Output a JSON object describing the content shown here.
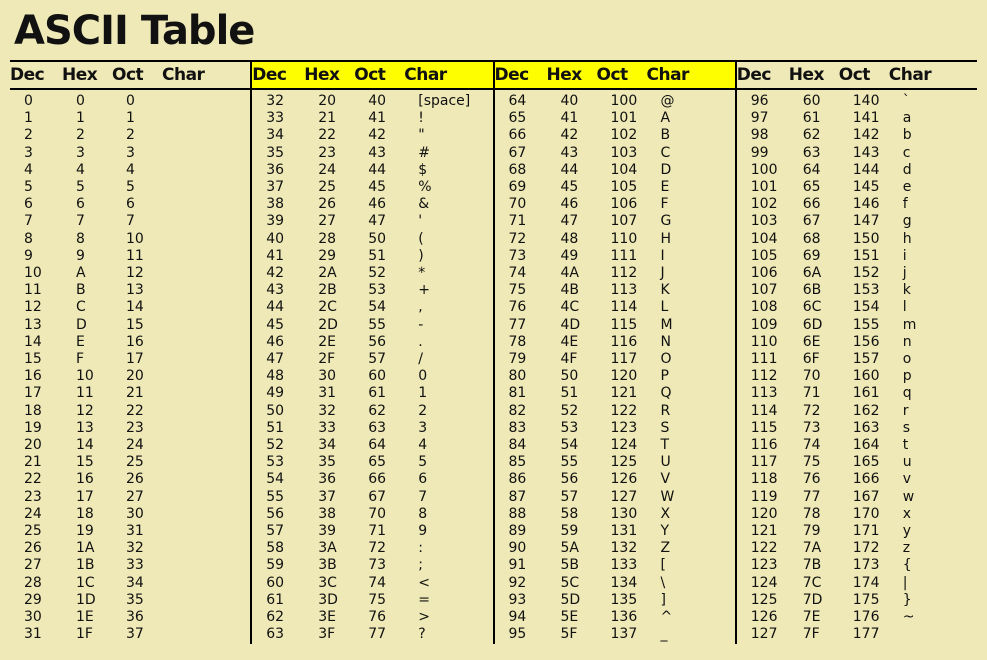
{
  "title": "ASCII Table",
  "headers": {
    "dec": "Dec",
    "hex": "Hex",
    "oct": "Oct",
    "char": "Char"
  },
  "highlight_columns": [
    1,
    2
  ],
  "columns": [
    [
      {
        "dec": "0",
        "hex": "0",
        "oct": "0",
        "char": ""
      },
      {
        "dec": "1",
        "hex": "1",
        "oct": "1",
        "char": ""
      },
      {
        "dec": "2",
        "hex": "2",
        "oct": "2",
        "char": ""
      },
      {
        "dec": "3",
        "hex": "3",
        "oct": "3",
        "char": ""
      },
      {
        "dec": "4",
        "hex": "4",
        "oct": "4",
        "char": ""
      },
      {
        "dec": "5",
        "hex": "5",
        "oct": "5",
        "char": ""
      },
      {
        "dec": "6",
        "hex": "6",
        "oct": "6",
        "char": ""
      },
      {
        "dec": "7",
        "hex": "7",
        "oct": "7",
        "char": ""
      },
      {
        "dec": "8",
        "hex": "8",
        "oct": "10",
        "char": ""
      },
      {
        "dec": "9",
        "hex": "9",
        "oct": "11",
        "char": ""
      },
      {
        "dec": "10",
        "hex": "A",
        "oct": "12",
        "char": ""
      },
      {
        "dec": "11",
        "hex": "B",
        "oct": "13",
        "char": ""
      },
      {
        "dec": "12",
        "hex": "C",
        "oct": "14",
        "char": ""
      },
      {
        "dec": "13",
        "hex": "D",
        "oct": "15",
        "char": ""
      },
      {
        "dec": "14",
        "hex": "E",
        "oct": "16",
        "char": ""
      },
      {
        "dec": "15",
        "hex": "F",
        "oct": "17",
        "char": ""
      },
      {
        "dec": "16",
        "hex": "10",
        "oct": "20",
        "char": ""
      },
      {
        "dec": "17",
        "hex": "11",
        "oct": "21",
        "char": ""
      },
      {
        "dec": "18",
        "hex": "12",
        "oct": "22",
        "char": ""
      },
      {
        "dec": "19",
        "hex": "13",
        "oct": "23",
        "char": ""
      },
      {
        "dec": "20",
        "hex": "14",
        "oct": "24",
        "char": ""
      },
      {
        "dec": "21",
        "hex": "15",
        "oct": "25",
        "char": ""
      },
      {
        "dec": "22",
        "hex": "16",
        "oct": "26",
        "char": ""
      },
      {
        "dec": "23",
        "hex": "17",
        "oct": "27",
        "char": ""
      },
      {
        "dec": "24",
        "hex": "18",
        "oct": "30",
        "char": ""
      },
      {
        "dec": "25",
        "hex": "19",
        "oct": "31",
        "char": ""
      },
      {
        "dec": "26",
        "hex": "1A",
        "oct": "32",
        "char": ""
      },
      {
        "dec": "27",
        "hex": "1B",
        "oct": "33",
        "char": ""
      },
      {
        "dec": "28",
        "hex": "1C",
        "oct": "34",
        "char": ""
      },
      {
        "dec": "29",
        "hex": "1D",
        "oct": "35",
        "char": ""
      },
      {
        "dec": "30",
        "hex": "1E",
        "oct": "36",
        "char": ""
      },
      {
        "dec": "31",
        "hex": "1F",
        "oct": "37",
        "char": ""
      }
    ],
    [
      {
        "dec": "32",
        "hex": "20",
        "oct": "40",
        "char": "[space]"
      },
      {
        "dec": "33",
        "hex": "21",
        "oct": "41",
        "char": "!"
      },
      {
        "dec": "34",
        "hex": "22",
        "oct": "42",
        "char": "\""
      },
      {
        "dec": "35",
        "hex": "23",
        "oct": "43",
        "char": "#"
      },
      {
        "dec": "36",
        "hex": "24",
        "oct": "44",
        "char": "$"
      },
      {
        "dec": "37",
        "hex": "25",
        "oct": "45",
        "char": "%"
      },
      {
        "dec": "38",
        "hex": "26",
        "oct": "46",
        "char": "&"
      },
      {
        "dec": "39",
        "hex": "27",
        "oct": "47",
        "char": "'"
      },
      {
        "dec": "40",
        "hex": "28",
        "oct": "50",
        "char": "("
      },
      {
        "dec": "41",
        "hex": "29",
        "oct": "51",
        "char": ")"
      },
      {
        "dec": "42",
        "hex": "2A",
        "oct": "52",
        "char": "*"
      },
      {
        "dec": "43",
        "hex": "2B",
        "oct": "53",
        "char": "+"
      },
      {
        "dec": "44",
        "hex": "2C",
        "oct": "54",
        "char": ","
      },
      {
        "dec": "45",
        "hex": "2D",
        "oct": "55",
        "char": "-"
      },
      {
        "dec": "46",
        "hex": "2E",
        "oct": "56",
        "char": "."
      },
      {
        "dec": "47",
        "hex": "2F",
        "oct": "57",
        "char": "/"
      },
      {
        "dec": "48",
        "hex": "30",
        "oct": "60",
        "char": "0"
      },
      {
        "dec": "49",
        "hex": "31",
        "oct": "61",
        "char": "1"
      },
      {
        "dec": "50",
        "hex": "32",
        "oct": "62",
        "char": "2"
      },
      {
        "dec": "51",
        "hex": "33",
        "oct": "63",
        "char": "3"
      },
      {
        "dec": "52",
        "hex": "34",
        "oct": "64",
        "char": "4"
      },
      {
        "dec": "53",
        "hex": "35",
        "oct": "65",
        "char": "5"
      },
      {
        "dec": "54",
        "hex": "36",
        "oct": "66",
        "char": "6"
      },
      {
        "dec": "55",
        "hex": "37",
        "oct": "67",
        "char": "7"
      },
      {
        "dec": "56",
        "hex": "38",
        "oct": "70",
        "char": "8"
      },
      {
        "dec": "57",
        "hex": "39",
        "oct": "71",
        "char": "9"
      },
      {
        "dec": "58",
        "hex": "3A",
        "oct": "72",
        "char": ":"
      },
      {
        "dec": "59",
        "hex": "3B",
        "oct": "73",
        "char": ";"
      },
      {
        "dec": "60",
        "hex": "3C",
        "oct": "74",
        "char": "<"
      },
      {
        "dec": "61",
        "hex": "3D",
        "oct": "75",
        "char": "="
      },
      {
        "dec": "62",
        "hex": "3E",
        "oct": "76",
        "char": ">"
      },
      {
        "dec": "63",
        "hex": "3F",
        "oct": "77",
        "char": "?"
      }
    ],
    [
      {
        "dec": "64",
        "hex": "40",
        "oct": "100",
        "char": "@"
      },
      {
        "dec": "65",
        "hex": "41",
        "oct": "101",
        "char": "A"
      },
      {
        "dec": "66",
        "hex": "42",
        "oct": "102",
        "char": "B"
      },
      {
        "dec": "67",
        "hex": "43",
        "oct": "103",
        "char": "C"
      },
      {
        "dec": "68",
        "hex": "44",
        "oct": "104",
        "char": "D"
      },
      {
        "dec": "69",
        "hex": "45",
        "oct": "105",
        "char": "E"
      },
      {
        "dec": "70",
        "hex": "46",
        "oct": "106",
        "char": "F"
      },
      {
        "dec": "71",
        "hex": "47",
        "oct": "107",
        "char": "G"
      },
      {
        "dec": "72",
        "hex": "48",
        "oct": "110",
        "char": "H"
      },
      {
        "dec": "73",
        "hex": "49",
        "oct": "111",
        "char": "I"
      },
      {
        "dec": "74",
        "hex": "4A",
        "oct": "112",
        "char": "J"
      },
      {
        "dec": "75",
        "hex": "4B",
        "oct": "113",
        "char": "K"
      },
      {
        "dec": "76",
        "hex": "4C",
        "oct": "114",
        "char": "L"
      },
      {
        "dec": "77",
        "hex": "4D",
        "oct": "115",
        "char": "M"
      },
      {
        "dec": "78",
        "hex": "4E",
        "oct": "116",
        "char": "N"
      },
      {
        "dec": "79",
        "hex": "4F",
        "oct": "117",
        "char": "O"
      },
      {
        "dec": "80",
        "hex": "50",
        "oct": "120",
        "char": "P"
      },
      {
        "dec": "81",
        "hex": "51",
        "oct": "121",
        "char": "Q"
      },
      {
        "dec": "82",
        "hex": "52",
        "oct": "122",
        "char": "R"
      },
      {
        "dec": "83",
        "hex": "53",
        "oct": "123",
        "char": "S"
      },
      {
        "dec": "84",
        "hex": "54",
        "oct": "124",
        "char": "T"
      },
      {
        "dec": "85",
        "hex": "55",
        "oct": "125",
        "char": "U"
      },
      {
        "dec": "86",
        "hex": "56",
        "oct": "126",
        "char": "V"
      },
      {
        "dec": "87",
        "hex": "57",
        "oct": "127",
        "char": "W"
      },
      {
        "dec": "88",
        "hex": "58",
        "oct": "130",
        "char": "X"
      },
      {
        "dec": "89",
        "hex": "59",
        "oct": "131",
        "char": "Y"
      },
      {
        "dec": "90",
        "hex": "5A",
        "oct": "132",
        "char": "Z"
      },
      {
        "dec": "91",
        "hex": "5B",
        "oct": "133",
        "char": "["
      },
      {
        "dec": "92",
        "hex": "5C",
        "oct": "134",
        "char": "\\"
      },
      {
        "dec": "93",
        "hex": "5D",
        "oct": "135",
        "char": "]"
      },
      {
        "dec": "94",
        "hex": "5E",
        "oct": "136",
        "char": "^"
      },
      {
        "dec": "95",
        "hex": "5F",
        "oct": "137",
        "char": "_"
      }
    ],
    [
      {
        "dec": "96",
        "hex": "60",
        "oct": "140",
        "char": "`"
      },
      {
        "dec": "97",
        "hex": "61",
        "oct": "141",
        "char": "a"
      },
      {
        "dec": "98",
        "hex": "62",
        "oct": "142",
        "char": "b"
      },
      {
        "dec": "99",
        "hex": "63",
        "oct": "143",
        "char": "c"
      },
      {
        "dec": "100",
        "hex": "64",
        "oct": "144",
        "char": "d"
      },
      {
        "dec": "101",
        "hex": "65",
        "oct": "145",
        "char": "e"
      },
      {
        "dec": "102",
        "hex": "66",
        "oct": "146",
        "char": "f"
      },
      {
        "dec": "103",
        "hex": "67",
        "oct": "147",
        "char": "g"
      },
      {
        "dec": "104",
        "hex": "68",
        "oct": "150",
        "char": "h"
      },
      {
        "dec": "105",
        "hex": "69",
        "oct": "151",
        "char": "i"
      },
      {
        "dec": "106",
        "hex": "6A",
        "oct": "152",
        "char": "j"
      },
      {
        "dec": "107",
        "hex": "6B",
        "oct": "153",
        "char": "k"
      },
      {
        "dec": "108",
        "hex": "6C",
        "oct": "154",
        "char": "l"
      },
      {
        "dec": "109",
        "hex": "6D",
        "oct": "155",
        "char": "m"
      },
      {
        "dec": "110",
        "hex": "6E",
        "oct": "156",
        "char": "n"
      },
      {
        "dec": "111",
        "hex": "6F",
        "oct": "157",
        "char": "o"
      },
      {
        "dec": "112",
        "hex": "70",
        "oct": "160",
        "char": "p"
      },
      {
        "dec": "113",
        "hex": "71",
        "oct": "161",
        "char": "q"
      },
      {
        "dec": "114",
        "hex": "72",
        "oct": "162",
        "char": "r"
      },
      {
        "dec": "115",
        "hex": "73",
        "oct": "163",
        "char": "s"
      },
      {
        "dec": "116",
        "hex": "74",
        "oct": "164",
        "char": "t"
      },
      {
        "dec": "117",
        "hex": "75",
        "oct": "165",
        "char": "u"
      },
      {
        "dec": "118",
        "hex": "76",
        "oct": "166",
        "char": "v"
      },
      {
        "dec": "119",
        "hex": "77",
        "oct": "167",
        "char": "w"
      },
      {
        "dec": "120",
        "hex": "78",
        "oct": "170",
        "char": "x"
      },
      {
        "dec": "121",
        "hex": "79",
        "oct": "171",
        "char": "y"
      },
      {
        "dec": "122",
        "hex": "7A",
        "oct": "172",
        "char": "z"
      },
      {
        "dec": "123",
        "hex": "7B",
        "oct": "173",
        "char": "{"
      },
      {
        "dec": "124",
        "hex": "7C",
        "oct": "174",
        "char": "|"
      },
      {
        "dec": "125",
        "hex": "7D",
        "oct": "175",
        "char": "}"
      },
      {
        "dec": "126",
        "hex": "7E",
        "oct": "176",
        "char": "~"
      },
      {
        "dec": "127",
        "hex": "7F",
        "oct": "177",
        "char": ""
      }
    ]
  ]
}
